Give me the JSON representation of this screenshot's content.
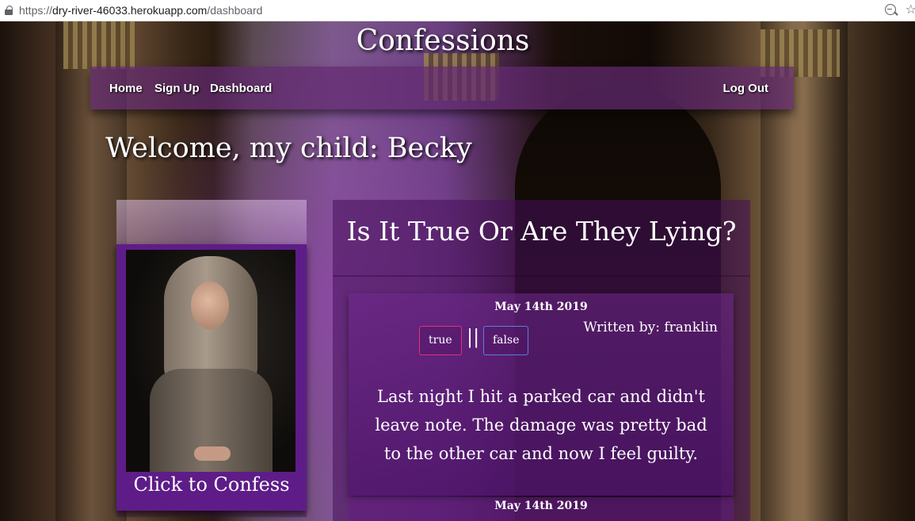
{
  "browser": {
    "url_protocol": "https://",
    "url_host": "dry-river-46033.herokuapp.com",
    "url_path": "/dashboard"
  },
  "site": {
    "title": "Confessions"
  },
  "nav": {
    "items": [
      {
        "label": "Home"
      },
      {
        "label": "Sign Up"
      },
      {
        "label": "Dashboard"
      }
    ],
    "logout_label": "Log Out"
  },
  "welcome": {
    "text": "Welcome, my child: Becky"
  },
  "confess_card": {
    "label": "Click to Confess"
  },
  "feed": {
    "title": "Is It True Or Are They Lying?",
    "posts": [
      {
        "date": "May 14th 2019",
        "author": "Written by: franklin",
        "true_label": "true",
        "separator": "||",
        "false_label": "false",
        "body": "Last night I hit a parked car and didn't leave note. The damage was pretty bad to the other car and now I feel guilty."
      },
      {
        "date": "May 14th 2019"
      }
    ]
  }
}
